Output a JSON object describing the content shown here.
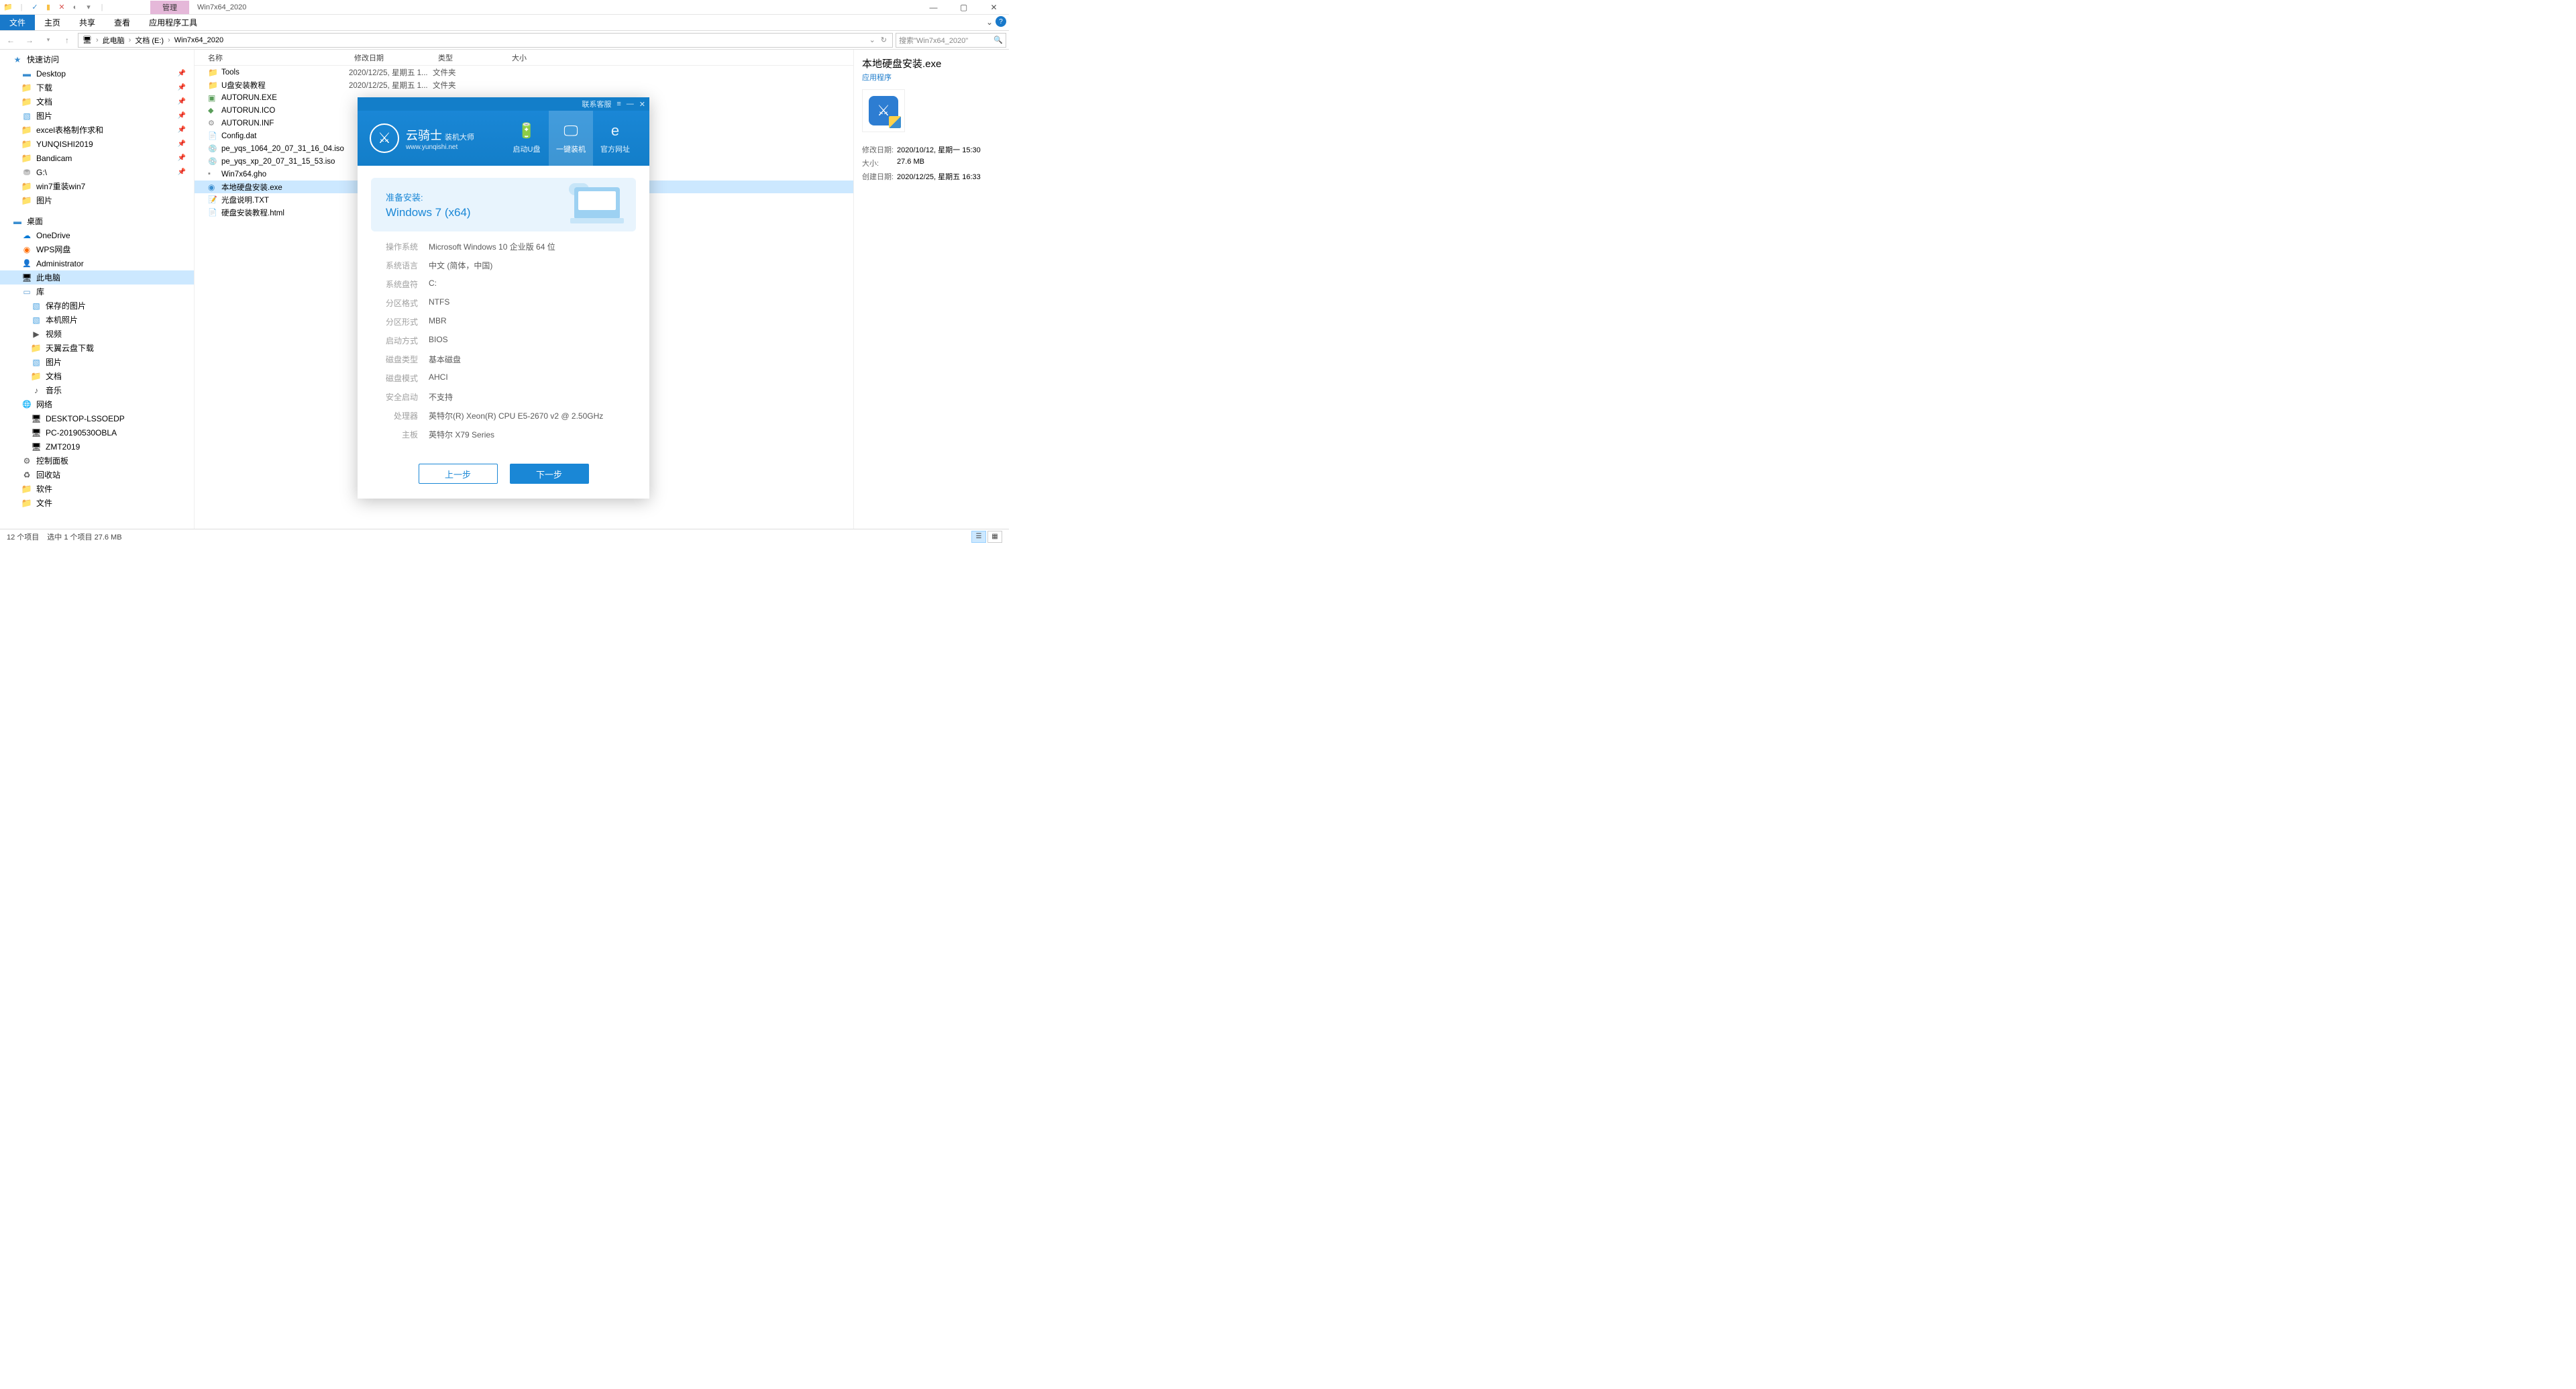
{
  "window": {
    "title": "Win7x64_2020",
    "contextualTab": "管理"
  },
  "ribbon": {
    "file": "文件",
    "tabs": [
      "主页",
      "共享",
      "查看",
      "应用程序工具"
    ]
  },
  "breadcrumb": [
    "此电脑",
    "文档 (E:)",
    "Win7x64_2020"
  ],
  "search": {
    "placeholder": "搜索\"Win7x64_2020\""
  },
  "nav": {
    "quick": {
      "label": "快速访问",
      "items": [
        "Desktop",
        "下载",
        "文档",
        "图片",
        "excel表格制作求和",
        "YUNQISHI2019",
        "Bandicam",
        "G:\\",
        "win7重装win7",
        "图片"
      ]
    },
    "desktop": {
      "label": "桌面",
      "items": [
        "OneDrive",
        "WPS网盘",
        "Administrator",
        "此电脑",
        "库",
        "保存的图片",
        "本机照片",
        "视频",
        "天翼云盘下载",
        "图片",
        "文档",
        "音乐",
        "网络",
        "DESKTOP-LSSOEDP",
        "PC-20190530OBLA",
        "ZMT2019",
        "控制面板",
        "回收站",
        "软件",
        "文件"
      ]
    }
  },
  "columns": {
    "name": "名称",
    "date": "修改日期",
    "type": "类型",
    "size": "大小"
  },
  "files": [
    {
      "name": "Tools",
      "date": "2020/12/25, 星期五 1...",
      "type": "文件夹",
      "icon": "folder"
    },
    {
      "name": "U盘安装教程",
      "date": "2020/12/25, 星期五 1...",
      "type": "文件夹",
      "icon": "folder"
    },
    {
      "name": "AUTORUN.EXE",
      "date": "",
      "type": "",
      "icon": "exe"
    },
    {
      "name": "AUTORUN.ICO",
      "date": "",
      "type": "",
      "icon": "ico"
    },
    {
      "name": "AUTORUN.INF",
      "date": "",
      "type": "",
      "icon": "inf"
    },
    {
      "name": "Config.dat",
      "date": "",
      "type": "",
      "icon": "dat"
    },
    {
      "name": "pe_yqs_1064_20_07_31_16_04.iso",
      "date": "",
      "type": "",
      "icon": "iso"
    },
    {
      "name": "pe_yqs_xp_20_07_31_15_53.iso",
      "date": "",
      "type": "",
      "icon": "iso"
    },
    {
      "name": "Win7x64.gho",
      "date": "",
      "type": "",
      "icon": "gho"
    },
    {
      "name": "本地硬盘安装.exe",
      "date": "",
      "type": "",
      "icon": "app",
      "selected": true
    },
    {
      "name": "光盘说明.TXT",
      "date": "",
      "type": "",
      "icon": "txt"
    },
    {
      "name": "硬盘安装教程.html",
      "date": "",
      "type": "",
      "icon": "html"
    }
  ],
  "details": {
    "title": "本地硬盘安装.exe",
    "subtitle": "应用程序",
    "rows": [
      {
        "label": "修改日期:",
        "value": "2020/10/12, 星期一 15:30"
      },
      {
        "label": "大小:",
        "value": "27.6 MB"
      },
      {
        "label": "创建日期:",
        "value": "2020/12/25, 星期五 16:33"
      }
    ]
  },
  "status": {
    "count": "12 个项目",
    "sel": "选中 1 个项目  27.6 MB"
  },
  "installer": {
    "titlebar": {
      "contact": "联系客服",
      "menu": "≡",
      "min": "—",
      "close": "✕"
    },
    "brand": {
      "cn": "云骑士",
      "sub": "装机大师",
      "url": "www.yunqishi.net"
    },
    "tabs": [
      {
        "icon": "🔋",
        "label": "启动U盘"
      },
      {
        "icon": "🖵",
        "label": "一键装机",
        "active": true
      },
      {
        "icon": "e",
        "label": "官方网址"
      }
    ],
    "banner": {
      "l1": "准备安装:",
      "l2": "Windows 7 (x64)"
    },
    "rows": [
      {
        "label": "操作系统",
        "value": "Microsoft Windows 10 企业版 64 位"
      },
      {
        "label": "系统语言",
        "value": "中文 (简体，中国)"
      },
      {
        "label": "系统盘符",
        "value": "C:"
      },
      {
        "label": "分区格式",
        "value": "NTFS"
      },
      {
        "label": "分区形式",
        "value": "MBR"
      },
      {
        "label": "启动方式",
        "value": "BIOS"
      },
      {
        "label": "磁盘类型",
        "value": "基本磁盘"
      },
      {
        "label": "磁盘模式",
        "value": "AHCI"
      },
      {
        "label": "安全启动",
        "value": "不支持"
      },
      {
        "label": "处理器",
        "value": "英特尔(R) Xeon(R) CPU E5-2670 v2 @ 2.50GHz"
      },
      {
        "label": "主板",
        "value": "英特尔 X79 Series"
      }
    ],
    "buttons": {
      "prev": "上一步",
      "next": "下一步"
    }
  }
}
